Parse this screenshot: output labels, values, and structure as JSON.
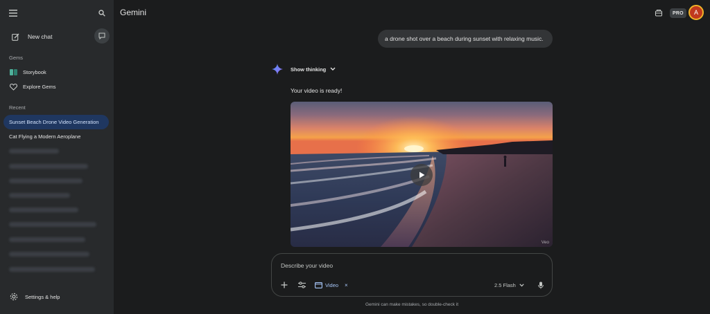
{
  "app": {
    "title": "Gemini"
  },
  "sidebar": {
    "new_chat_label": "New chat",
    "gems_heading": "Gems",
    "gems": [
      {
        "label": "Storybook",
        "icon": "storybook-icon"
      },
      {
        "label": "Explore Gems",
        "icon": "explore-gems-icon"
      }
    ],
    "recent_heading": "Recent",
    "recent": [
      {
        "label": "Sunset Beach Drone Video Generation",
        "active": true
      },
      {
        "label": "Cat Flying a Modern Aeroplane",
        "active": false
      }
    ],
    "settings_label": "Settings & help"
  },
  "header": {
    "pro_label": "PRO",
    "avatar_initial": "A"
  },
  "conversation": {
    "user_prompt": "a drone shot over a beach during sunset with relaxing music.",
    "show_thinking_label": "Show thinking",
    "response_text": "Your video is ready!",
    "video_watermark": "Veo"
  },
  "composer": {
    "placeholder": "Describe your video",
    "chip_label": "Video",
    "chip_close": "×",
    "model_label": "2.5 Flash",
    "disclaimer": "Gemini can make mistakes, so double-check it"
  },
  "colors": {
    "background": "#1b1c1d",
    "sidebar": "#282a2c",
    "active_item": "#1f3760",
    "accent": "#a8c7fa"
  }
}
